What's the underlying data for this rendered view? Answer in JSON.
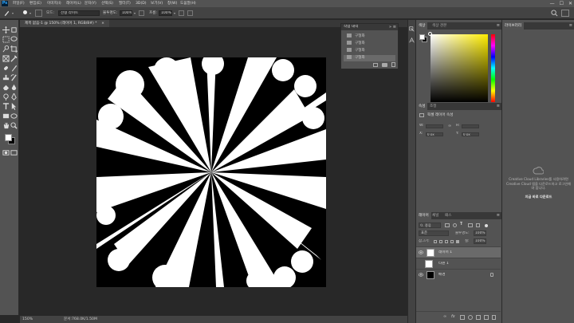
{
  "app": {
    "logo": "Ps"
  },
  "menubar": {
    "items": [
      "파일(F)",
      "편집(E)",
      "이미지(I)",
      "레이어(L)",
      "문자(Y)",
      "선택(S)",
      "필터(T)",
      "3D(D)",
      "보기(V)",
      "창(W)",
      "도움말(H)"
    ],
    "window_controls": [
      "—",
      "☐",
      "✕"
    ]
  },
  "options_bar": {
    "mode_label": "모드:",
    "mode_value": "선형 라이트",
    "opacity_label": "불투명도:",
    "opacity_value": "100%",
    "flow_label": "흐름:",
    "flow_value": "100%"
  },
  "document": {
    "tab_title": "제목 없음-1 @ 150% (레이어 1, RGB/8#) *",
    "tab_close": "×",
    "zoom": "150%",
    "status": "문서:768.0K/1.50M"
  },
  "history_panel": {
    "title": "작업 내역",
    "rows": [
      "구형화",
      "구형화",
      "구형화",
      "구형화"
    ],
    "selected_index": 3
  },
  "color_panel": {
    "tabs": [
      "색상",
      "색상 견본"
    ],
    "hue_color": "#ffee00"
  },
  "properties_panel": {
    "tabs": [
      "속성",
      "조정"
    ],
    "title": "픽셀 레이어 속성",
    "w_label": "W:",
    "h_label": "H:",
    "x_label": "X:",
    "y_label": "Y:",
    "x_value": "0 px",
    "y_value": "0 px",
    "link_glyph": "∞"
  },
  "layers_panel": {
    "tabs": [
      "레이어",
      "채널",
      "패스"
    ],
    "filter_label": "종류",
    "blend_mode": "표준",
    "opacity_label": "불투명도:",
    "opacity_value": "100%",
    "lock_label": "잠그기:",
    "fill_label": "칠:",
    "fill_value": "100%",
    "layers": [
      {
        "name": "레이어 1",
        "thumb": "#ffffff",
        "selected": true
      },
      {
        "name": "타원 1",
        "thumb": "#ffffff",
        "selected": false
      },
      {
        "name": "배경",
        "thumb": "#000000",
        "selected": false
      }
    ]
  },
  "library_panel": {
    "tab": "라이브러리",
    "message": "Creative Cloud Libraries를 사용하려면 Creative Cloud 앱을 다운로드하고 로그인해야 합니다.",
    "link": "지금 바로 다운로드"
  }
}
